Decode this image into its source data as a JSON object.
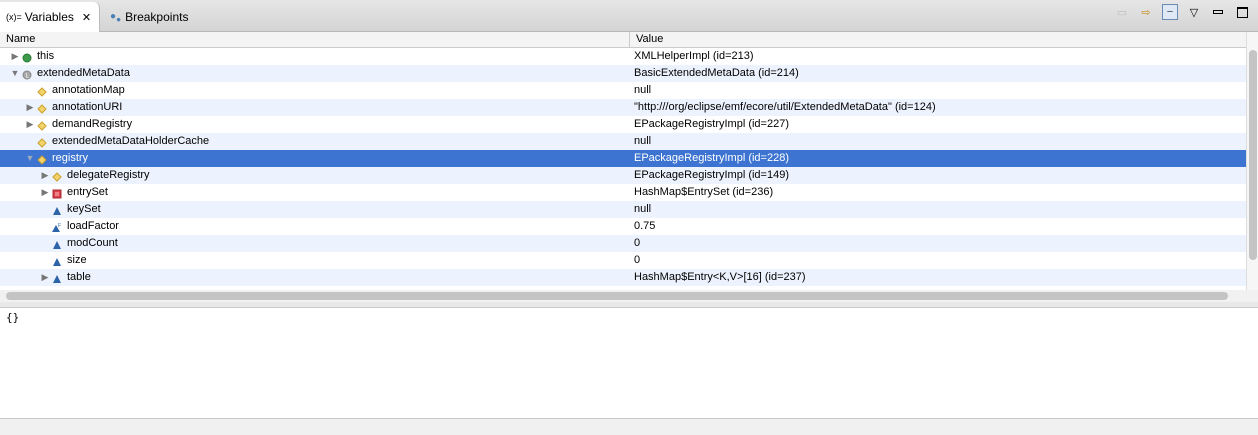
{
  "tabs": [
    {
      "label": "Variables",
      "icon": "variables-icon"
    },
    {
      "label": "Breakpoints",
      "icon": "breakpoints-icon"
    }
  ],
  "variables_icon_text": "(x)=",
  "columns": {
    "name": "Name",
    "value": "Value"
  },
  "rows": [
    {
      "name": "this",
      "value": "XMLHelperImpl  (id=213)",
      "depth": 0,
      "toggle": "collapsed",
      "icon": "object-green"
    },
    {
      "name": "extendedMetaData",
      "value": "BasicExtendedMetaData  (id=214)",
      "depth": 0,
      "toggle": "expanded",
      "icon": "local-gray"
    },
    {
      "name": "annotationMap",
      "value": "null",
      "depth": 1,
      "toggle": "none",
      "icon": "field-protected"
    },
    {
      "name": "annotationURI",
      "value": "\"http:///org/eclipse/emf/ecore/util/ExtendedMetaData\" (id=124)",
      "depth": 1,
      "toggle": "collapsed",
      "icon": "field-protected"
    },
    {
      "name": "demandRegistry",
      "value": "EPackageRegistryImpl  (id=227)",
      "depth": 1,
      "toggle": "collapsed",
      "icon": "field-protected"
    },
    {
      "name": "extendedMetaDataHolderCache",
      "value": "null",
      "depth": 1,
      "toggle": "none",
      "icon": "field-protected"
    },
    {
      "name": "registry",
      "value": "EPackageRegistryImpl  (id=228)",
      "depth": 1,
      "toggle": "expanded",
      "icon": "field-protected",
      "selected": true
    },
    {
      "name": "delegateRegistry",
      "value": "EPackageRegistryImpl  (id=149)",
      "depth": 2,
      "toggle": "collapsed",
      "icon": "field-protected"
    },
    {
      "name": "entrySet",
      "value": "HashMap$EntrySet  (id=236)",
      "depth": 2,
      "toggle": "collapsed",
      "icon": "field-private"
    },
    {
      "name": "keySet",
      "value": "null",
      "depth": 2,
      "toggle": "none",
      "icon": "field-default"
    },
    {
      "name": "loadFactor",
      "value": "0.75",
      "depth": 2,
      "toggle": "none",
      "icon": "field-default-final"
    },
    {
      "name": "modCount",
      "value": "0",
      "depth": 2,
      "toggle": "none",
      "icon": "field-default"
    },
    {
      "name": "size",
      "value": "0",
      "depth": 2,
      "toggle": "none",
      "icon": "field-default"
    },
    {
      "name": "table",
      "value": "HashMap$Entry<K,V>[16]  (id=237)",
      "depth": 2,
      "toggle": "collapsed",
      "icon": "field-default"
    }
  ],
  "detail_text": "{}",
  "colors": {
    "selection": "#3d74d1",
    "stripe": "#edf3fe"
  }
}
